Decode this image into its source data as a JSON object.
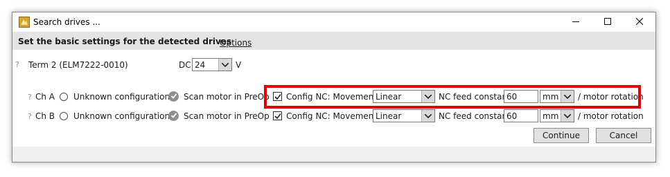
{
  "window": {
    "title": "Search drives ...",
    "minimize_icon": "minimize-icon",
    "maximize_icon": "maximize-icon",
    "close_icon": "close-icon"
  },
  "header": {
    "title": "Set the basic settings for the detected drives",
    "options_link": "Options"
  },
  "terminal": {
    "help": "?",
    "name": "Term 2 (ELM7222-0010)",
    "dc_label": "DC",
    "dc_value": "24",
    "unit": "V"
  },
  "channels": [
    {
      "help": "?",
      "label": "Ch A",
      "unknown_config": "Unknown configuration.",
      "scan_motor": "Scan motor in PreOp",
      "config_nc": "Config NC: Movement",
      "config_nc_checked": true,
      "movement": "Linear",
      "feed_label": "NC feed constant",
      "feed_value": "60",
      "feed_unit": "mm",
      "per_label": "/ motor rotation"
    },
    {
      "help": "?",
      "label": "Ch B",
      "unknown_config": "Unknown configuration.",
      "scan_motor": "Scan motor in PreOp",
      "config_nc": "Config NC: Movement",
      "config_nc_checked": true,
      "movement": "Linear",
      "feed_label": "NC feed constant",
      "feed_value": "60",
      "feed_unit": "mm",
      "per_label": "/ motor rotation"
    }
  ],
  "buttons": {
    "continue": "Continue",
    "cancel": "Cancel"
  },
  "colors": {
    "highlight": "#e30000",
    "header_band": "#e4e4e4"
  }
}
